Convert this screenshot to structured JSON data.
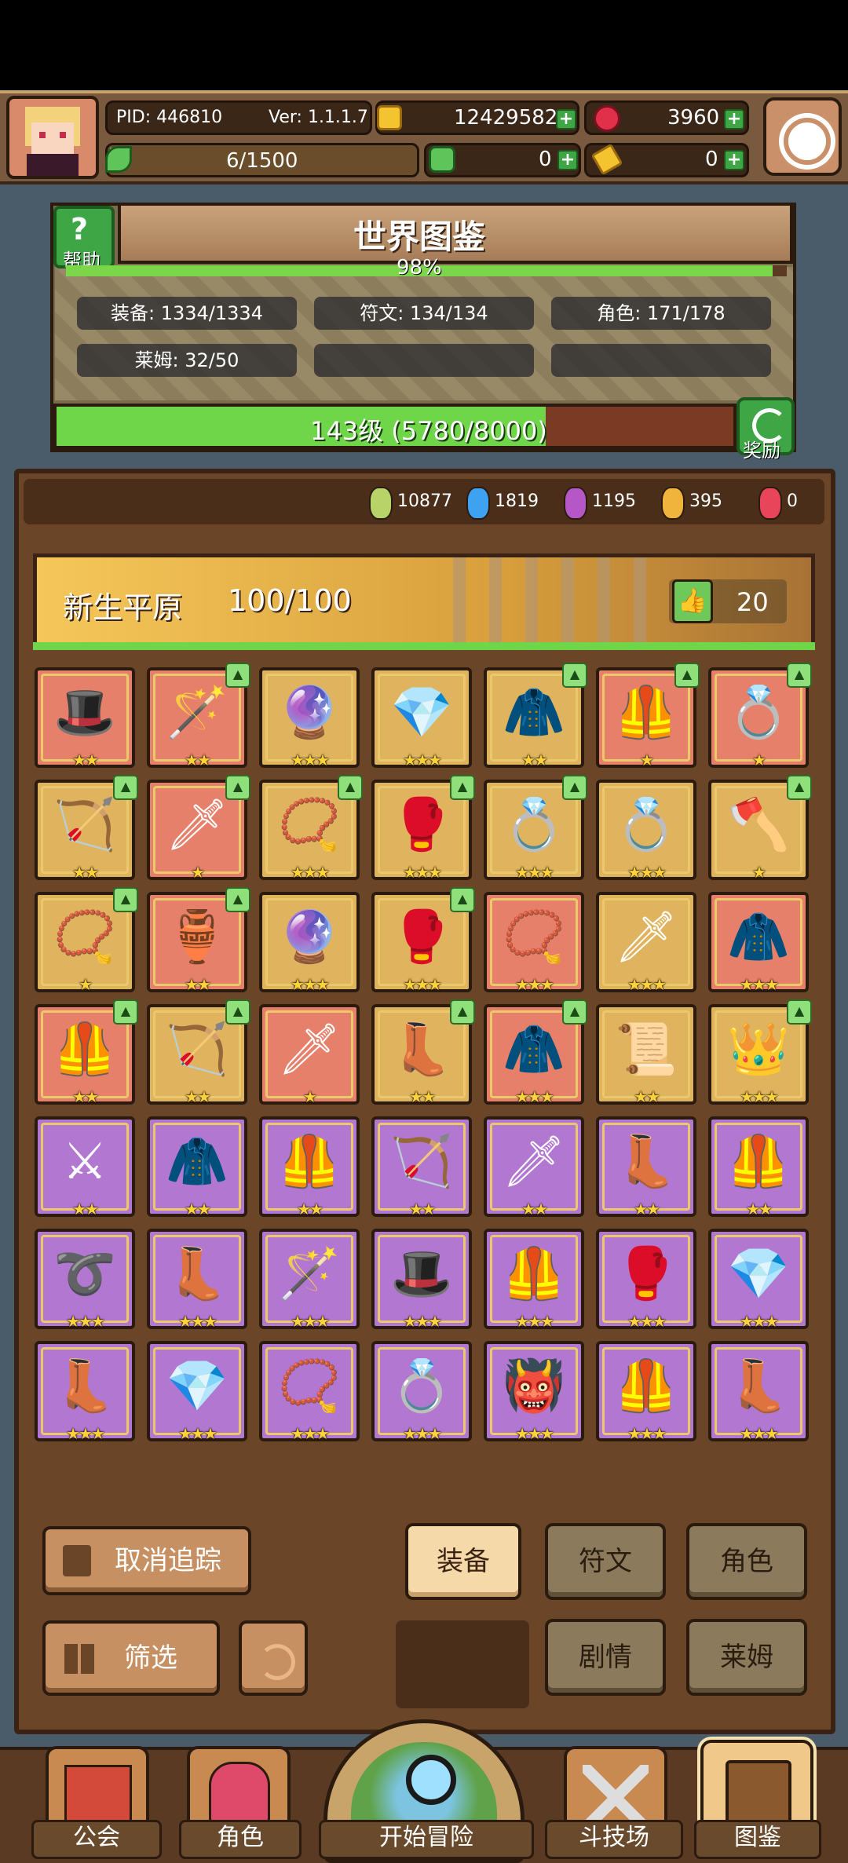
{
  "header": {
    "pid": "PID: 446810",
    "version": "Ver: 1.1.1.7",
    "gold": "12429582",
    "ruby": "3960",
    "stamina": "6/1500",
    "clover": "0",
    "key": "0"
  },
  "wiki": {
    "help_label": "帮助",
    "title": "世界图鉴",
    "percent": "98%",
    "percent_value": 0.98,
    "stats": [
      "装备: 1334/1334",
      "符文: 134/134",
      "角色: 171/178",
      "莱姆: 32/50"
    ],
    "level_text": "143级 (5780/8000)",
    "level_progress": 0.7225,
    "reward_label": "奖励"
  },
  "gems": [
    "10877",
    "1819",
    "1195",
    "395",
    "0"
  ],
  "gem_colors": [
    "#b8d468",
    "#3ea2f0",
    "#b657c8",
    "#f0b43c",
    "#e8455a"
  ],
  "zone": {
    "name": "新生平原",
    "progress": "100/100",
    "likes": "20"
  },
  "items": [
    {
      "color": "red",
      "icon": "hat",
      "stars": 2,
      "thumb": false
    },
    {
      "color": "red",
      "icon": "staff",
      "stars": 2,
      "thumb": true
    },
    {
      "color": "gold",
      "icon": "orb",
      "stars": 3,
      "thumb": false
    },
    {
      "color": "gold",
      "icon": "gem",
      "stars": 3,
      "thumb": false
    },
    {
      "color": "gold",
      "icon": "hood",
      "stars": 2,
      "thumb": true
    },
    {
      "color": "red",
      "icon": "armor",
      "stars": 1,
      "thumb": true
    },
    {
      "color": "red",
      "icon": "ring",
      "stars": 1,
      "thumb": true
    },
    {
      "color": "gold",
      "icon": "crossbow",
      "stars": 2,
      "thumb": true
    },
    {
      "color": "red",
      "icon": "spear",
      "stars": 1,
      "thumb": true
    },
    {
      "color": "gold",
      "icon": "necklace",
      "stars": 3,
      "thumb": true
    },
    {
      "color": "gold",
      "icon": "bracer",
      "stars": 3,
      "thumb": true
    },
    {
      "color": "gold",
      "icon": "ring",
      "stars": 3,
      "thumb": true
    },
    {
      "color": "gold",
      "icon": "ring",
      "stars": 3,
      "thumb": false
    },
    {
      "color": "gold",
      "icon": "axe",
      "stars": 1,
      "thumb": true
    },
    {
      "color": "gold",
      "icon": "necklace",
      "stars": 1,
      "thumb": true
    },
    {
      "color": "red",
      "icon": "potion",
      "stars": 2,
      "thumb": true
    },
    {
      "color": "gold",
      "icon": "orb",
      "stars": 3,
      "thumb": false
    },
    {
      "color": "gold",
      "icon": "bracer",
      "stars": 3,
      "thumb": true
    },
    {
      "color": "red",
      "icon": "necklace",
      "stars": 3,
      "thumb": false
    },
    {
      "color": "gold",
      "icon": "spear",
      "stars": 3,
      "thumb": false
    },
    {
      "color": "red",
      "icon": "hood",
      "stars": 3,
      "thumb": false
    },
    {
      "color": "red",
      "icon": "armor",
      "stars": 2,
      "thumb": true
    },
    {
      "color": "gold",
      "icon": "bow",
      "stars": 2,
      "thumb": true
    },
    {
      "color": "red",
      "icon": "spear",
      "stars": 1,
      "thumb": false
    },
    {
      "color": "gold",
      "icon": "boots",
      "stars": 2,
      "thumb": true
    },
    {
      "color": "red",
      "icon": "hood",
      "stars": 3,
      "thumb": true
    },
    {
      "color": "gold",
      "icon": "scroll",
      "stars": 2,
      "thumb": false
    },
    {
      "color": "gold",
      "icon": "crown",
      "stars": 3,
      "thumb": true
    },
    {
      "color": "purple",
      "icon": "sword",
      "stars": 2,
      "thumb": false
    },
    {
      "color": "purple",
      "icon": "hood",
      "stars": 2,
      "thumb": false
    },
    {
      "color": "purple",
      "icon": "armor",
      "stars": 2,
      "thumb": false
    },
    {
      "color": "purple",
      "icon": "crossbow",
      "stars": 2,
      "thumb": false
    },
    {
      "color": "purple",
      "icon": "spear",
      "stars": 2,
      "thumb": false
    },
    {
      "color": "purple",
      "icon": "boots",
      "stars": 2,
      "thumb": false
    },
    {
      "color": "purple",
      "icon": "armor",
      "stars": 2,
      "thumb": false
    },
    {
      "color": "purple",
      "icon": "belt",
      "stars": 3,
      "thumb": false
    },
    {
      "color": "purple",
      "icon": "boots",
      "stars": 3,
      "thumb": false
    },
    {
      "color": "purple",
      "icon": "staff",
      "stars": 3,
      "thumb": false
    },
    {
      "color": "purple",
      "icon": "hat",
      "stars": 3,
      "thumb": false
    },
    {
      "color": "purple",
      "icon": "armor",
      "stars": 3,
      "thumb": false
    },
    {
      "color": "purple",
      "icon": "bracer",
      "stars": 3,
      "thumb": false
    },
    {
      "color": "purple",
      "icon": "gem",
      "stars": 3,
      "thumb": false
    },
    {
      "color": "purple",
      "icon": "boots",
      "stars": 3,
      "thumb": false
    },
    {
      "color": "purple",
      "icon": "gem",
      "stars": 3,
      "thumb": false
    },
    {
      "color": "purple",
      "icon": "necklace",
      "stars": 3,
      "thumb": false
    },
    {
      "color": "purple",
      "icon": "ring",
      "stars": 3,
      "thumb": false
    },
    {
      "color": "purple",
      "icon": "mask",
      "stars": 3,
      "thumb": false
    },
    {
      "color": "purple",
      "icon": "armor",
      "stars": 3,
      "thumb": false
    },
    {
      "color": "purple",
      "icon": "boots",
      "stars": 3,
      "thumb": false
    }
  ],
  "buttons": {
    "untrack": "取消追踪",
    "filter": "筛选",
    "tab_equip": "装备",
    "tab_rune": "符文",
    "tab_character": "角色",
    "tab_story": "剧情",
    "tab_slime": "莱姆"
  },
  "nav": [
    "公会",
    "角色",
    "开始冒险",
    "斗技场",
    "图鉴"
  ]
}
